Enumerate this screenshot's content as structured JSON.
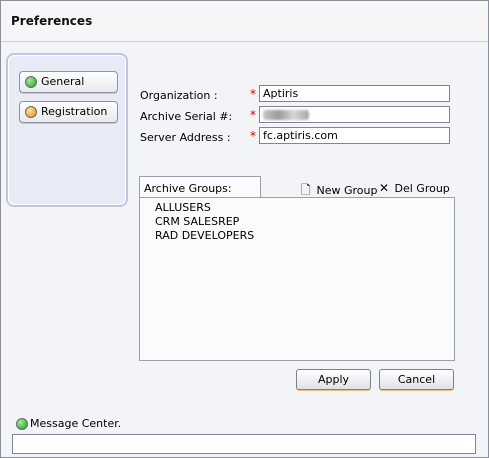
{
  "window": {
    "title": "Preferences"
  },
  "nav": {
    "items": [
      {
        "label": "General",
        "status": "green"
      },
      {
        "label": "Registration",
        "status": "orange"
      }
    ]
  },
  "form": {
    "organization": {
      "label": "Organization :",
      "value": "Aptiris",
      "required": "*"
    },
    "archive_serial": {
      "label": "Archive Serial #:",
      "value": "",
      "required": "*"
    },
    "server_address": {
      "label": "Server Address :",
      "value": "fc.aptiris.com",
      "required": "*"
    }
  },
  "archive_groups": {
    "header": "Archive Groups:",
    "new_group_label": "New Group",
    "del_group_label": "Del Group",
    "items": [
      "ALLUSERS",
      "CRM SALESREP",
      "RAD DEVELOPERS"
    ]
  },
  "buttons": {
    "apply": "Apply",
    "cancel": "Cancel"
  },
  "message_center": {
    "label": "Message Center.",
    "text": ""
  },
  "colors": {
    "required": "#d40000",
    "status_green": "#1e9a1a",
    "status_orange": "#e08f10"
  },
  "icons": {
    "new_group": "new-document-icon",
    "del_group": "close-x-icon"
  }
}
